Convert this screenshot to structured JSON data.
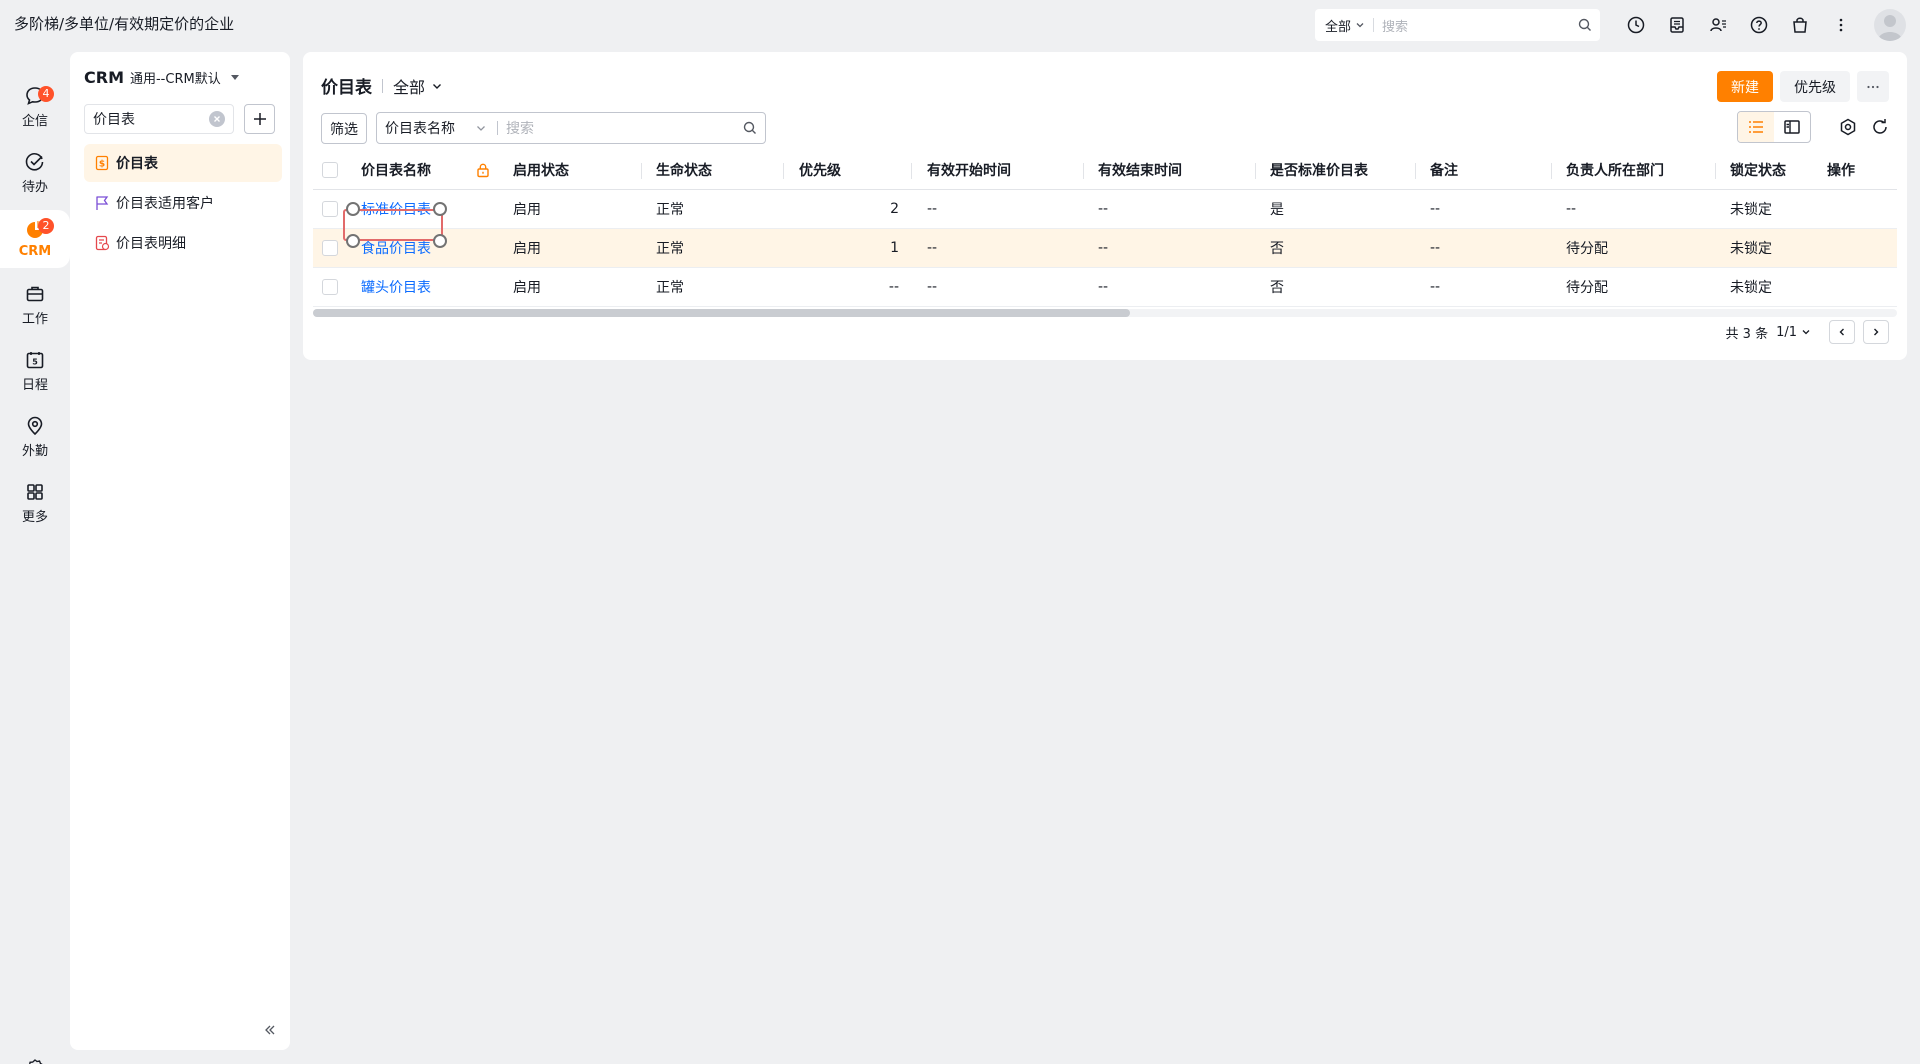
{
  "topbar": {
    "company": "多阶梯/多单位/有效期定价的企业",
    "search_scope": "全部",
    "search_placeholder": "搜索"
  },
  "rail": {
    "items": [
      {
        "label": "企信",
        "badge": "4",
        "icon": "chat-bubble-icon"
      },
      {
        "label": "待办",
        "badge": "",
        "icon": "check-circle-icon"
      },
      {
        "label": "CRM",
        "badge": "2",
        "icon": "crm-icon",
        "active": true
      },
      {
        "label": "工作",
        "badge": "",
        "icon": "briefcase-icon"
      },
      {
        "label": "日程",
        "badge": "",
        "icon": "calendar-icon"
      },
      {
        "label": "外勤",
        "badge": "",
        "icon": "location-pin-icon"
      },
      {
        "label": "更多",
        "badge": "",
        "icon": "grid-icon"
      }
    ],
    "calendar_day": "5"
  },
  "objpanel": {
    "app": "CRM",
    "app_sub": "通用--CRM默认",
    "search_value": "价目表",
    "items": [
      {
        "label": "价目表",
        "icon": "price-list-icon",
        "active": true
      },
      {
        "label": "价目表适用客户",
        "icon": "flag-icon"
      },
      {
        "label": "价目表明细",
        "icon": "price-detail-icon"
      }
    ]
  },
  "main": {
    "title": "价目表",
    "view": "全部",
    "btn_new": "新建",
    "btn_priority": "优先级",
    "filter_label": "筛选",
    "search_field": "价目表名称",
    "search_placeholder": "搜索"
  },
  "table": {
    "columns": [
      "价目表名称",
      "启用状态",
      "生命状态",
      "优先级",
      "有效开始时间",
      "有效结束时间",
      "是否标准价目表",
      "备注",
      "负责人所在部门",
      "锁定状态",
      "操作"
    ],
    "rows": [
      {
        "name": "标准价目表",
        "enabled": "启用",
        "life": "正常",
        "priority": "2",
        "start": "--",
        "end": "--",
        "standard": "是",
        "note": "--",
        "dept": "--",
        "lock": "未锁定"
      },
      {
        "name": "食品价目表",
        "enabled": "启用",
        "life": "正常",
        "priority": "1",
        "start": "--",
        "end": "--",
        "standard": "否",
        "note": "--",
        "dept": "待分配",
        "lock": "未锁定"
      },
      {
        "name": "罐头价目表",
        "enabled": "启用",
        "life": "正常",
        "priority": "--",
        "start": "--",
        "end": "--",
        "standard": "否",
        "note": "--",
        "dept": "待分配",
        "lock": "未锁定"
      }
    ]
  },
  "pager": {
    "total": "共 3 条",
    "page": "1/1"
  },
  "colors": {
    "accent": "#ff8000",
    "link": "#0c6cff",
    "badge": "#ff522a",
    "highlight_row": "#fff5e6"
  }
}
